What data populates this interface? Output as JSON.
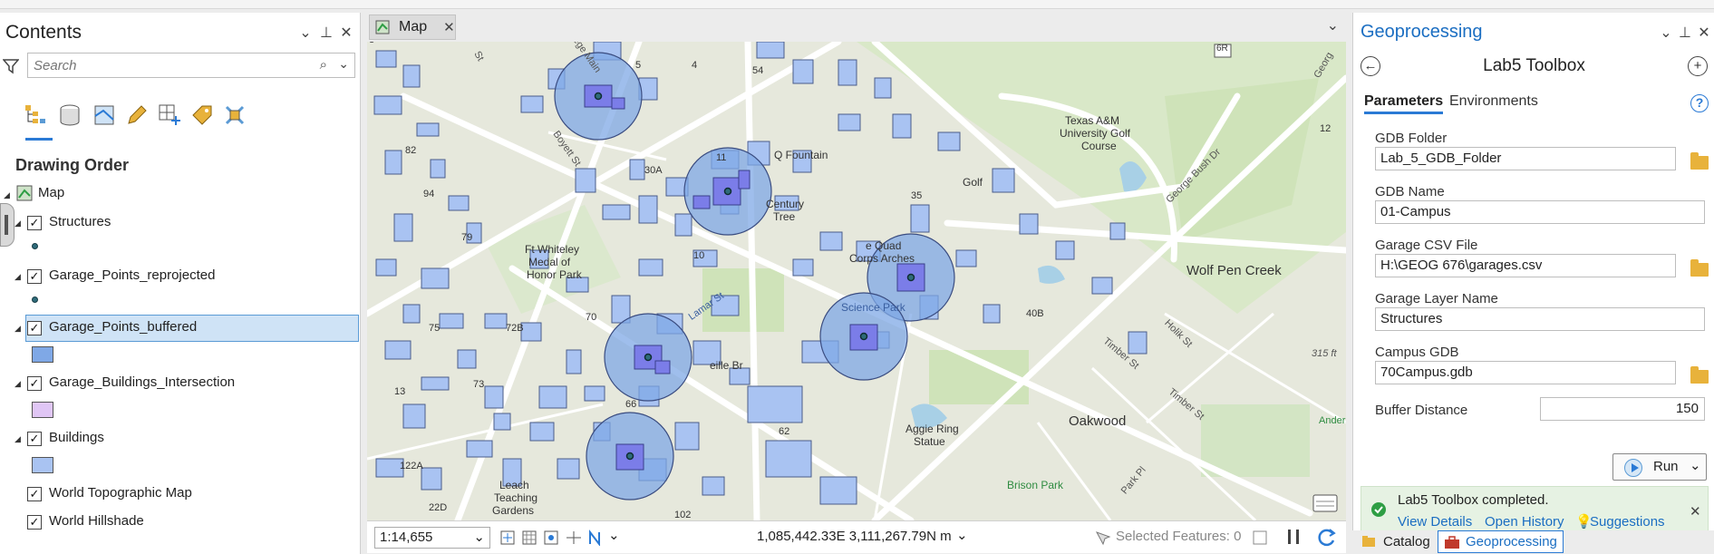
{
  "contents": {
    "title": "Contents",
    "search_placeholder": "Search",
    "drawing_order": "Drawing Order",
    "map_label": "Map",
    "layers": [
      {
        "name": "Structures",
        "checked": true
      },
      {
        "name": "Garage_Points_reprojected",
        "checked": true
      },
      {
        "name": "Garage_Points_buffered",
        "checked": true,
        "selected": true
      },
      {
        "name": "Garage_Buildings_Intersection",
        "checked": true
      },
      {
        "name": "Buildings",
        "checked": true
      },
      {
        "name": "World Topographic Map",
        "checked": true
      },
      {
        "name": "World Hillshade",
        "checked": true
      }
    ]
  },
  "map": {
    "tab_label": "Map",
    "scale": "1:14,655",
    "coordinates": "1,085,442.33E 3,111,267.79N m",
    "selected_features": "Selected Features: 0",
    "labels": {
      "college_main": "ollege Main",
      "boyett": "Boyett St",
      "st_top": "St",
      "n8": "8",
      "n5": "5",
      "n4": "4",
      "n54": "54",
      "n6r": "6R",
      "n82": "82",
      "n94": "94",
      "n79": "79",
      "n75": "75",
      "n13": "13",
      "n73": "73",
      "n72b": "72B",
      "n70": "70",
      "n30a": "30A",
      "n11": "11",
      "n10": "10",
      "n35": "35",
      "n40b": "40B",
      "n62": "62",
      "n66": "66",
      "n122a": "122A",
      "n22d": "22D",
      "n102": "102",
      "n12": "12",
      "fountain": "Q Fountain",
      "century_tree_1": "Century",
      "century_tree_2": "Tree",
      "golf": "Golf",
      "quad_1": "e Quad",
      "quad_2": "Corps Arches",
      "whiteley_1": "Ft Whiteley",
      "whiteley_2": "Medal of",
      "whiteley_3": "Honor Park",
      "lamar": "Lamar St",
      "science_park": "Science Park",
      "neville": "eille Br",
      "aggie_ring_1": "Aggie Ring",
      "aggie_ring_2": "Statue",
      "leach_1": "Leach",
      "leach_2": "Teaching",
      "leach_3": "Gardens",
      "golf_course_1": "Texas A&M",
      "golf_course_2": "University Golf",
      "golf_course_3": "Course",
      "george_bush": "George Bush Dr",
      "wolf_pen": "Wolf Pen Creek",
      "holik": "Holik St",
      "timber1": "Timber St",
      "timber2": "Timber St",
      "oakwood": "Oakwood",
      "park_pl": "Park Pl",
      "brison": "Brison Park",
      "anders": "Anders",
      "ft315": "315 ft",
      "georg": "Georg"
    }
  },
  "geoprocessing": {
    "title": "Geoprocessing",
    "tool_title": "Lab5 Toolbox",
    "tabs": [
      "Parameters",
      "Environments"
    ],
    "params": [
      {
        "label": "GDB Folder",
        "value": "Lab_5_GDB_Folder",
        "folder": true
      },
      {
        "label": "GDB Name",
        "value": "01-Campus",
        "folder": false
      },
      {
        "label": "Garage CSV File",
        "value": "H:\\GEOG 676\\garages.csv",
        "folder": true
      },
      {
        "label": "Garage Layer Name",
        "value": "Structures",
        "folder": false
      },
      {
        "label": "Campus GDB",
        "value": "70Campus.gdb",
        "folder": true
      }
    ],
    "buffer_label": "Buffer Distance",
    "buffer_value": "150",
    "run_label": "Run",
    "message": "Lab5 Toolbox completed.",
    "view_details": "View Details",
    "open_history": "Open History",
    "suggestions": "Suggestions",
    "bottom_tabs": [
      "Catalog",
      "Geoprocessing"
    ]
  },
  "colors": {
    "accent": "#2a7ad5",
    "buffer_fill": "#7fa8e6",
    "building_fill": "#a9c3f2",
    "intersection_fill": "#7b7de8",
    "success": "#2e9e44"
  }
}
